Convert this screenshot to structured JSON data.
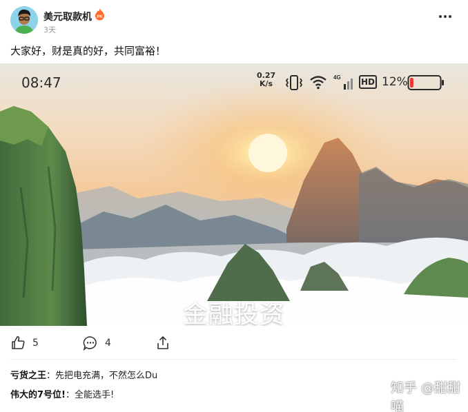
{
  "post": {
    "author": "美元取款机",
    "badge": "PK",
    "time": "3天",
    "text": "大家好，财是真的好，共同富裕！"
  },
  "image": {
    "status_time": "08:47",
    "status_speed_value": "0.27",
    "status_speed_unit": "K/s",
    "status_network": "4G",
    "status_hd": "HD",
    "status_battery": "12%",
    "battery_level": 0.12,
    "caption": "金融投资"
  },
  "actions": {
    "likes": "5",
    "comments": "4"
  },
  "comments": [
    {
      "name": "亏货之王",
      "text": "：先把电充满，不然怎么Du"
    },
    {
      "name": "伟大的7号位!",
      "text": "：全能选手!"
    }
  ],
  "watermark": "知乎 @甜甜喵",
  "colors": {
    "badge": "#ff6a2a",
    "battery_low": "#e53935"
  }
}
